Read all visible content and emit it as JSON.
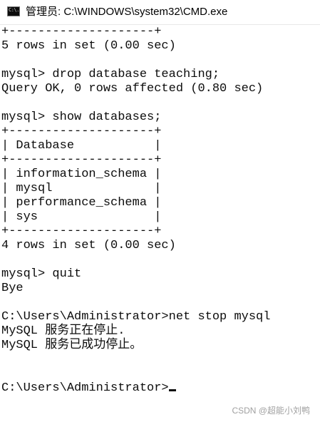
{
  "window": {
    "title": "管理员: C:\\WINDOWS\\system32\\CMD.exe",
    "icon_label": "C:\\."
  },
  "console": {
    "lines": [
      "+--------------------+",
      "5 rows in set (0.00 sec)",
      "",
      "mysql> drop database teaching;",
      "Query OK, 0 rows affected (0.80 sec)",
      "",
      "mysql> show databases;",
      "+--------------------+",
      "| Database           |",
      "+--------------------+",
      "| information_schema |",
      "| mysql              |",
      "| performance_schema |",
      "| sys                |",
      "+--------------------+",
      "4 rows in set (0.00 sec)",
      "",
      "mysql> quit",
      "Bye",
      "",
      "C:\\Users\\Administrator>net stop mysql",
      "MySQL 服务正在停止.",
      "MySQL 服务已成功停止。",
      "",
      "",
      "C:\\Users\\Administrator>"
    ]
  },
  "watermark": "CSDN @超能小刘鸭"
}
